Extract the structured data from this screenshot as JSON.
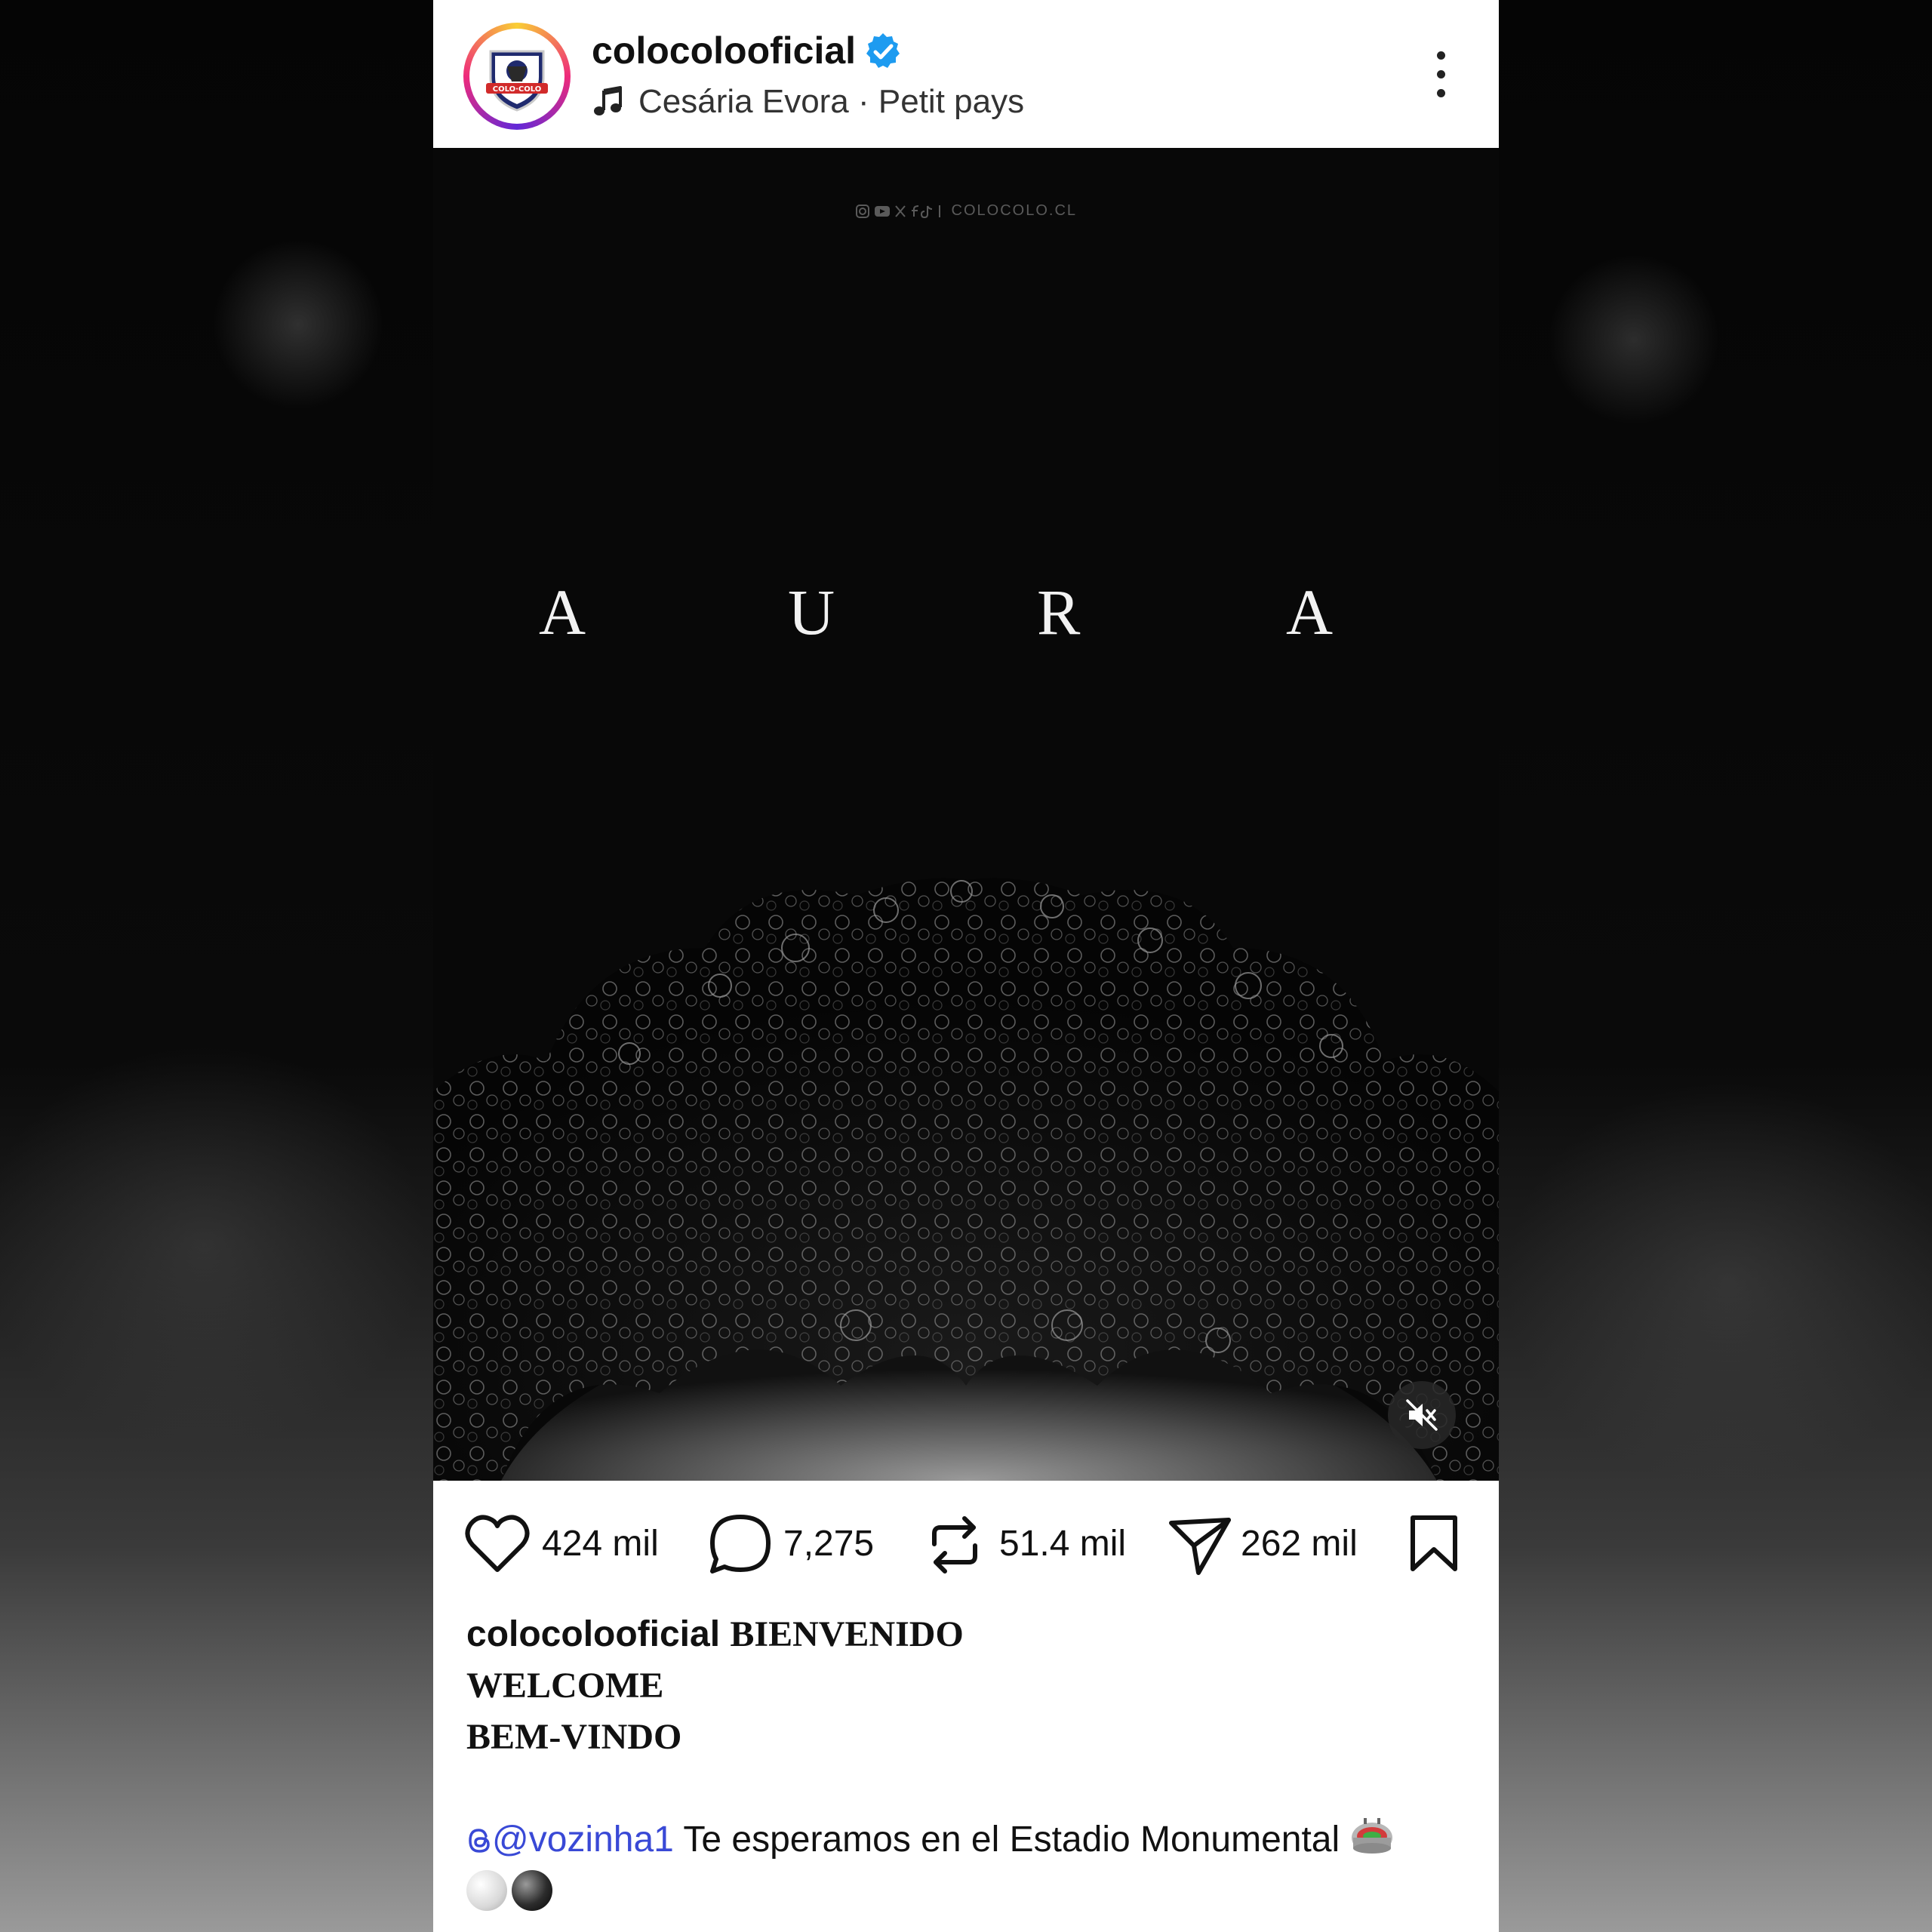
{
  "header": {
    "username": "colocolooficial",
    "verified": true,
    "music_icon": "music-note-icon",
    "song": "Cesária Evora · Petit pays",
    "more_icon": "more-vertical-icon"
  },
  "media": {
    "watermark": "COLOCOLO.CL",
    "title_letters": [
      "A",
      "U",
      "R",
      "A"
    ],
    "mute_icon": "volume-muted-icon"
  },
  "actions": {
    "likes": "424 mil",
    "comments": "7,275",
    "reposts": "51.4 mil",
    "shares": "262 mil"
  },
  "caption": {
    "username": "colocolooficial",
    "line1": "BIENVENIDO",
    "line2": "WELCOME",
    "line3": "BEM-VINDO",
    "mention": "@vozinha1",
    "message": "Te esperamos en el Estadio Monumental"
  },
  "colors": {
    "link": "#3949d6",
    "verified": "#1d9bf0",
    "background": "#050505"
  }
}
